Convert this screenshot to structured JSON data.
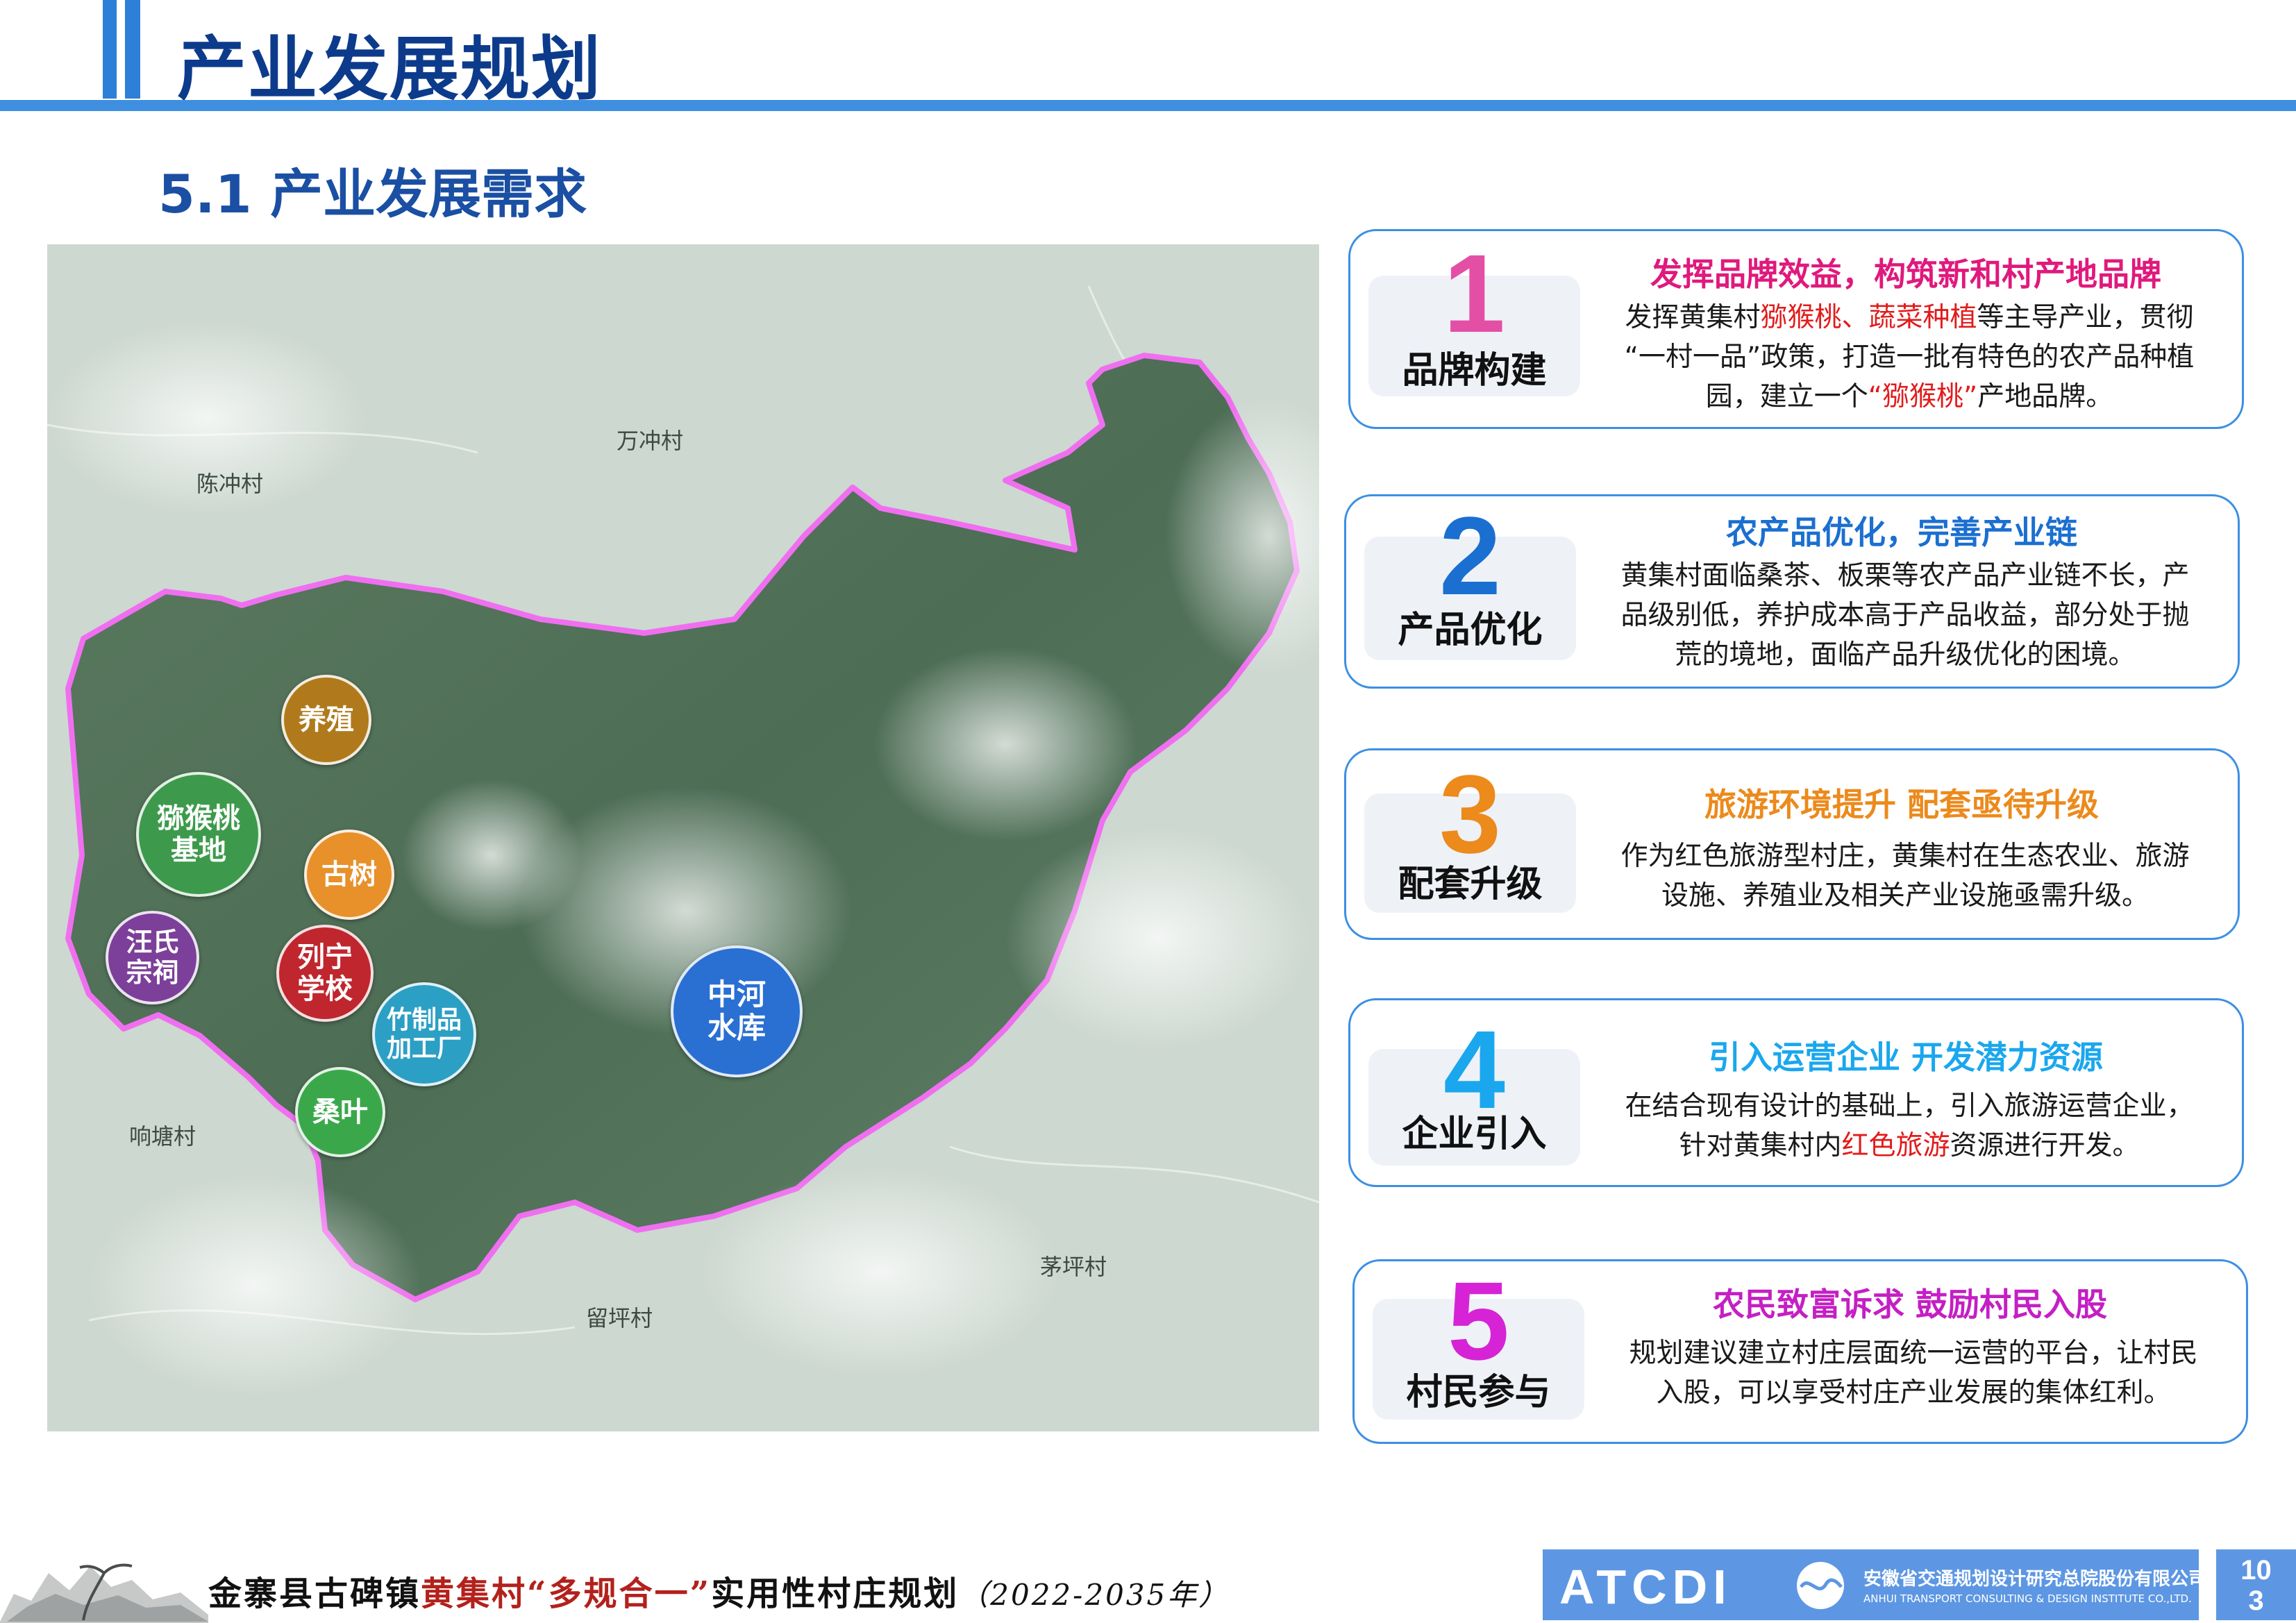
{
  "header": {
    "title": "产业发展规划"
  },
  "section": {
    "title": "5.1 产业发展需求"
  },
  "map": {
    "villages": {
      "chenchong": "陈冲村",
      "wanchong": "万冲村",
      "xiangtang": "响塘村",
      "liuping": "留坪村",
      "maoping": "茅坪村"
    },
    "markers": {
      "yangzhi": {
        "label": "养殖",
        "color": "#b07a1c"
      },
      "mihoutao_l1": "猕猴桃",
      "mihoutao_l2": "基地",
      "mihoutao_color": "#3d9a4c",
      "gushu": {
        "label": "古树",
        "color": "#e8902a"
      },
      "wangshi_l1": "汪氏",
      "wangshi_l2": "宗祠",
      "wangshi_color": "#7c3f9a",
      "liening_l1": "列宁",
      "liening_l2": "学校",
      "liening_color": "#c0262e",
      "zhuzhipin_l1": "竹制品",
      "zhuzhipin_l2": "加工厂",
      "zhuzhipin_color": "#2c9fc4",
      "sangye": {
        "label": "桑叶",
        "color": "#3aa84a"
      },
      "zhonghe_l1": "中河",
      "zhonghe_l2": "水库",
      "zhonghe_color": "#2a6fd2"
    },
    "boundary_color": "#f06ff0"
  },
  "cards": [
    {
      "number": "1",
      "number_color": "#e44fa6",
      "title_color": "#e0197d",
      "keyword": "品牌构建",
      "title": "发挥品牌效益，构筑新和村产地品牌",
      "b1": "发挥黄集村",
      "b1_red": "猕猴桃、蔬菜种植",
      "b2": "等主导产业，贯彻",
      "b3": "“一村一品”政策，打造一批有特色的农产品种植",
      "b4": "园，建立一个",
      "b4_red": "“猕猴桃”",
      "b5": "产地品牌。"
    },
    {
      "number": "2",
      "number_color": "#1b6fd0",
      "title_color": "#1b6fd0",
      "keyword": "产品优化",
      "title": "农产品优化，完善产业链",
      "l1": "黄集村面临桑茶、板栗等农产品产业链不长，产",
      "l2": "品级别低，养护成本高于产品收益，部分处于抛",
      "l3": "荒的境地，面临产品升级优化的困境。"
    },
    {
      "number": "3",
      "number_color": "#ec8a1c",
      "title_color": "#ec8a1c",
      "keyword": "配套升级",
      "title": "旅游环境提升 配套亟待升级",
      "l1": "作为红色旅游型村庄，黄集村在生态农业、旅游",
      "l2": "设施、养殖业及相关产业设施亟需升级。"
    },
    {
      "number": "4",
      "number_color": "#1aa7ee",
      "title_color": "#1aa7ee",
      "keyword": "企业引入",
      "title": "引入运营企业 开发潜力资源",
      "l1": "在结合现有设计的基础上，引入旅游运营企业，",
      "l2a": "针对黄集村内",
      "l2_red": "红色旅游",
      "l2b": "资源进行开发。"
    },
    {
      "number": "5",
      "number_color": "#d723d6",
      "title_color": "#c41fc4",
      "keyword": "村民参与",
      "title": "农民致富诉求 鼓励村民入股",
      "l1": "规划建议建立村庄层面统一运营的平台，让村民",
      "l2": "入股，可以享受村庄产业发展的集体红利。"
    }
  ],
  "footer": {
    "title_a": "金寨县古碑镇",
    "title_hl": "黄集村“多规合一”",
    "title_b": "实用性村庄规划",
    "years": "（2022-2035年）",
    "logo_text": "ATCDI",
    "company_cn": "安徽省交通规划设计研究总院股份有限公司",
    "company_en": "ANHUI TRANSPORT CONSULTING & DESIGN INSTITUTE CO.,LTD.",
    "page_l1": "10",
    "page_l2": "3"
  }
}
